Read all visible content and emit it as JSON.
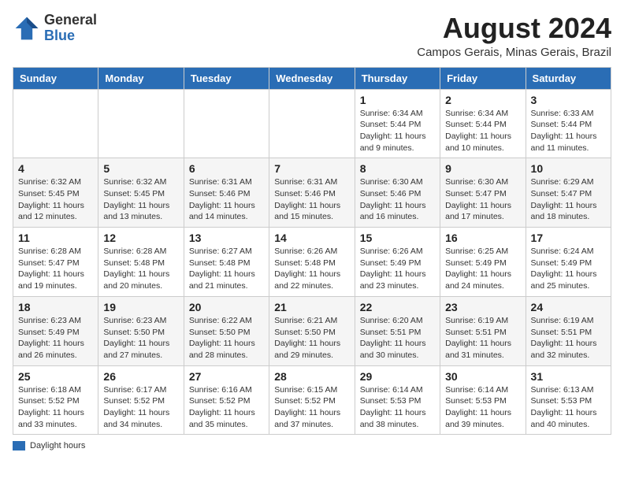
{
  "header": {
    "logo_general": "General",
    "logo_blue": "Blue",
    "month_year": "August 2024",
    "location": "Campos Gerais, Minas Gerais, Brazil"
  },
  "days_of_week": [
    "Sunday",
    "Monday",
    "Tuesday",
    "Wednesday",
    "Thursday",
    "Friday",
    "Saturday"
  ],
  "weeks": [
    [
      {
        "day": "",
        "detail": ""
      },
      {
        "day": "",
        "detail": ""
      },
      {
        "day": "",
        "detail": ""
      },
      {
        "day": "",
        "detail": ""
      },
      {
        "day": "1",
        "detail": "Sunrise: 6:34 AM\nSunset: 5:44 PM\nDaylight: 11 hours and 9 minutes."
      },
      {
        "day": "2",
        "detail": "Sunrise: 6:34 AM\nSunset: 5:44 PM\nDaylight: 11 hours and 10 minutes."
      },
      {
        "day": "3",
        "detail": "Sunrise: 6:33 AM\nSunset: 5:44 PM\nDaylight: 11 hours and 11 minutes."
      }
    ],
    [
      {
        "day": "4",
        "detail": "Sunrise: 6:32 AM\nSunset: 5:45 PM\nDaylight: 11 hours and 12 minutes."
      },
      {
        "day": "5",
        "detail": "Sunrise: 6:32 AM\nSunset: 5:45 PM\nDaylight: 11 hours and 13 minutes."
      },
      {
        "day": "6",
        "detail": "Sunrise: 6:31 AM\nSunset: 5:46 PM\nDaylight: 11 hours and 14 minutes."
      },
      {
        "day": "7",
        "detail": "Sunrise: 6:31 AM\nSunset: 5:46 PM\nDaylight: 11 hours and 15 minutes."
      },
      {
        "day": "8",
        "detail": "Sunrise: 6:30 AM\nSunset: 5:46 PM\nDaylight: 11 hours and 16 minutes."
      },
      {
        "day": "9",
        "detail": "Sunrise: 6:30 AM\nSunset: 5:47 PM\nDaylight: 11 hours and 17 minutes."
      },
      {
        "day": "10",
        "detail": "Sunrise: 6:29 AM\nSunset: 5:47 PM\nDaylight: 11 hours and 18 minutes."
      }
    ],
    [
      {
        "day": "11",
        "detail": "Sunrise: 6:28 AM\nSunset: 5:47 PM\nDaylight: 11 hours and 19 minutes."
      },
      {
        "day": "12",
        "detail": "Sunrise: 6:28 AM\nSunset: 5:48 PM\nDaylight: 11 hours and 20 minutes."
      },
      {
        "day": "13",
        "detail": "Sunrise: 6:27 AM\nSunset: 5:48 PM\nDaylight: 11 hours and 21 minutes."
      },
      {
        "day": "14",
        "detail": "Sunrise: 6:26 AM\nSunset: 5:48 PM\nDaylight: 11 hours and 22 minutes."
      },
      {
        "day": "15",
        "detail": "Sunrise: 6:26 AM\nSunset: 5:49 PM\nDaylight: 11 hours and 23 minutes."
      },
      {
        "day": "16",
        "detail": "Sunrise: 6:25 AM\nSunset: 5:49 PM\nDaylight: 11 hours and 24 minutes."
      },
      {
        "day": "17",
        "detail": "Sunrise: 6:24 AM\nSunset: 5:49 PM\nDaylight: 11 hours and 25 minutes."
      }
    ],
    [
      {
        "day": "18",
        "detail": "Sunrise: 6:23 AM\nSunset: 5:49 PM\nDaylight: 11 hours and 26 minutes."
      },
      {
        "day": "19",
        "detail": "Sunrise: 6:23 AM\nSunset: 5:50 PM\nDaylight: 11 hours and 27 minutes."
      },
      {
        "day": "20",
        "detail": "Sunrise: 6:22 AM\nSunset: 5:50 PM\nDaylight: 11 hours and 28 minutes."
      },
      {
        "day": "21",
        "detail": "Sunrise: 6:21 AM\nSunset: 5:50 PM\nDaylight: 11 hours and 29 minutes."
      },
      {
        "day": "22",
        "detail": "Sunrise: 6:20 AM\nSunset: 5:51 PM\nDaylight: 11 hours and 30 minutes."
      },
      {
        "day": "23",
        "detail": "Sunrise: 6:19 AM\nSunset: 5:51 PM\nDaylight: 11 hours and 31 minutes."
      },
      {
        "day": "24",
        "detail": "Sunrise: 6:19 AM\nSunset: 5:51 PM\nDaylight: 11 hours and 32 minutes."
      }
    ],
    [
      {
        "day": "25",
        "detail": "Sunrise: 6:18 AM\nSunset: 5:52 PM\nDaylight: 11 hours and 33 minutes."
      },
      {
        "day": "26",
        "detail": "Sunrise: 6:17 AM\nSunset: 5:52 PM\nDaylight: 11 hours and 34 minutes."
      },
      {
        "day": "27",
        "detail": "Sunrise: 6:16 AM\nSunset: 5:52 PM\nDaylight: 11 hours and 35 minutes."
      },
      {
        "day": "28",
        "detail": "Sunrise: 6:15 AM\nSunset: 5:52 PM\nDaylight: 11 hours and 37 minutes."
      },
      {
        "day": "29",
        "detail": "Sunrise: 6:14 AM\nSunset: 5:53 PM\nDaylight: 11 hours and 38 minutes."
      },
      {
        "day": "30",
        "detail": "Sunrise: 6:14 AM\nSunset: 5:53 PM\nDaylight: 11 hours and 39 minutes."
      },
      {
        "day": "31",
        "detail": "Sunrise: 6:13 AM\nSunset: 5:53 PM\nDaylight: 11 hours and 40 minutes."
      }
    ]
  ],
  "legend": {
    "label": "Daylight hours"
  }
}
